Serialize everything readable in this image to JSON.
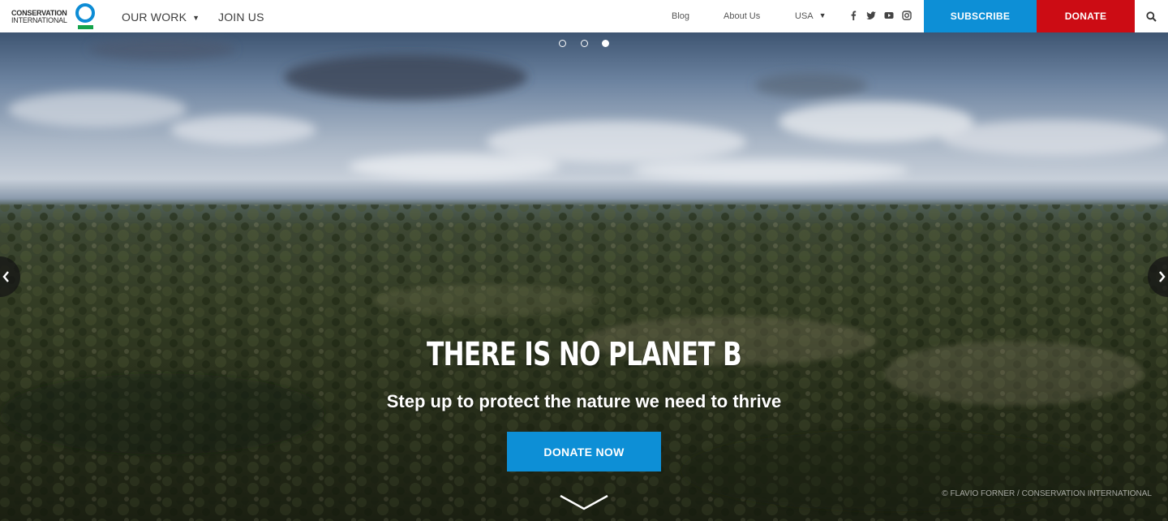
{
  "logo": {
    "line1": "CONSERVATION",
    "line2": "INTERNATIONAL",
    "ring_color": "#0d8cd5",
    "bar_color": "#14a34b"
  },
  "nav": {
    "our_work": "OUR WORK",
    "join_us": "JOIN US",
    "blog": "Blog",
    "about": "About Us",
    "country": "USA",
    "subscribe": "SUBSCRIBE",
    "donate": "DONATE",
    "social_icons": [
      "facebook-icon",
      "twitter-icon",
      "youtube-icon",
      "instagram-icon"
    ],
    "search_icon": "search-icon",
    "subscribe_color": "#0d8fd6",
    "donate_color": "#cc0c14"
  },
  "hero": {
    "headline": "THERE IS NO PLANET B",
    "subheadline": "Step up to protect the nature we need to thrive",
    "cta": "DONATE NOW",
    "credit": "© FLAVIO FORNER / CONSERVATION INTERNATIONAL",
    "slides_total": 3,
    "active_slide": 3,
    "cta_color": "#0d8fd6"
  }
}
